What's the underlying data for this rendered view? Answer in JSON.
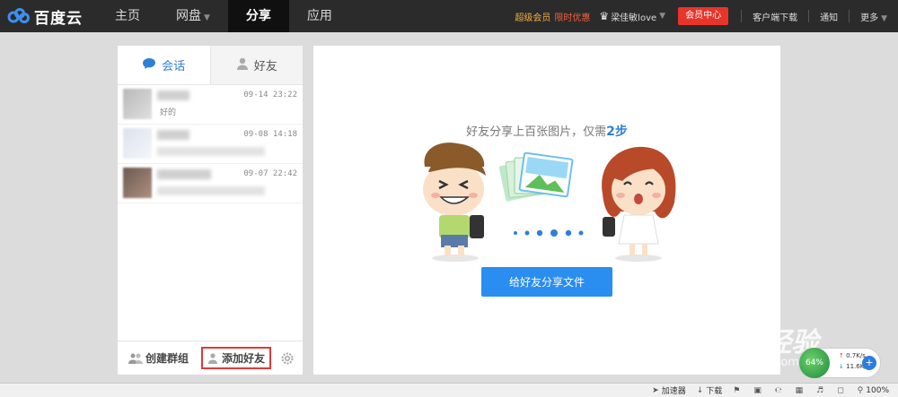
{
  "brand": {
    "name": "百度云"
  },
  "nav": [
    {
      "label": "主页",
      "active": false,
      "has_menu": false
    },
    {
      "label": "网盘",
      "active": false,
      "has_menu": true
    },
    {
      "label": "分享",
      "active": true,
      "has_menu": false
    },
    {
      "label": "应用",
      "active": false,
      "has_menu": false
    }
  ],
  "topbar": {
    "promo_label": "超级会员",
    "promo_highlight": "限时优惠",
    "username": "梁佳敏love",
    "vip_button": "会员中心",
    "client_download": "客户端下载",
    "notifications": "通知",
    "more": "更多"
  },
  "tabs": [
    {
      "label": "会话",
      "icon": "chat-bubble-icon",
      "active": true
    },
    {
      "label": "好友",
      "icon": "person-icon",
      "active": false
    }
  ],
  "chats": [
    {
      "time": "09-14 23:22",
      "preview": "好的"
    },
    {
      "time": "09-08 14:18",
      "preview": ""
    },
    {
      "time": "09-07 22:42",
      "preview": ""
    }
  ],
  "left_footer": {
    "create_group": "创建群组",
    "add_friend": "添加好友"
  },
  "main": {
    "headline_text": "好友分享上百张图片，仅需",
    "headline_num": "2步",
    "share_button": "给好友分享文件"
  },
  "watermark": {
    "text": "Bai度经验",
    "sub": "jingyan.baidu.com"
  },
  "speed_widget": {
    "percent": "64%",
    "up": "0.7K/s",
    "down": "11.6K/s"
  },
  "statusbar": {
    "accelerator": "加速器",
    "download": "下载",
    "zoom": "100%"
  },
  "colors": {
    "topbar_bg": "#2b2b2b",
    "accent_blue": "#2a8df0",
    "vip_red": "#e8342a",
    "highlight_border": "#e03a3a"
  }
}
